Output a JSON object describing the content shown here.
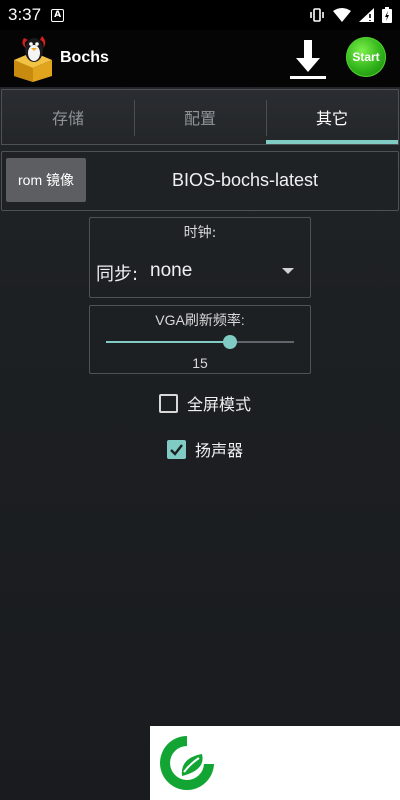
{
  "status_bar": {
    "time": "3:37",
    "notification_icon": "A"
  },
  "app": {
    "title": "Bochs",
    "start_label": "Start"
  },
  "tabs": [
    {
      "label": "存储",
      "active": false
    },
    {
      "label": "配置",
      "active": false
    },
    {
      "label": "其它",
      "active": true
    }
  ],
  "rom": {
    "button_label": "rom 镜像",
    "value": "BIOS-bochs-latest"
  },
  "clock": {
    "caption": "时钟:",
    "label": "同步:",
    "selected": "none"
  },
  "vga": {
    "caption": "VGA刷新频率:",
    "value": "15",
    "slider_fraction": 0.66
  },
  "options": {
    "fullscreen_label": "全屏模式",
    "fullscreen_checked": false,
    "speaker_label": "扬声器",
    "speaker_checked": true
  },
  "colors": {
    "accent": "#80cbc4",
    "start_green": "#2fb21a",
    "brand_green": "#12a534"
  }
}
